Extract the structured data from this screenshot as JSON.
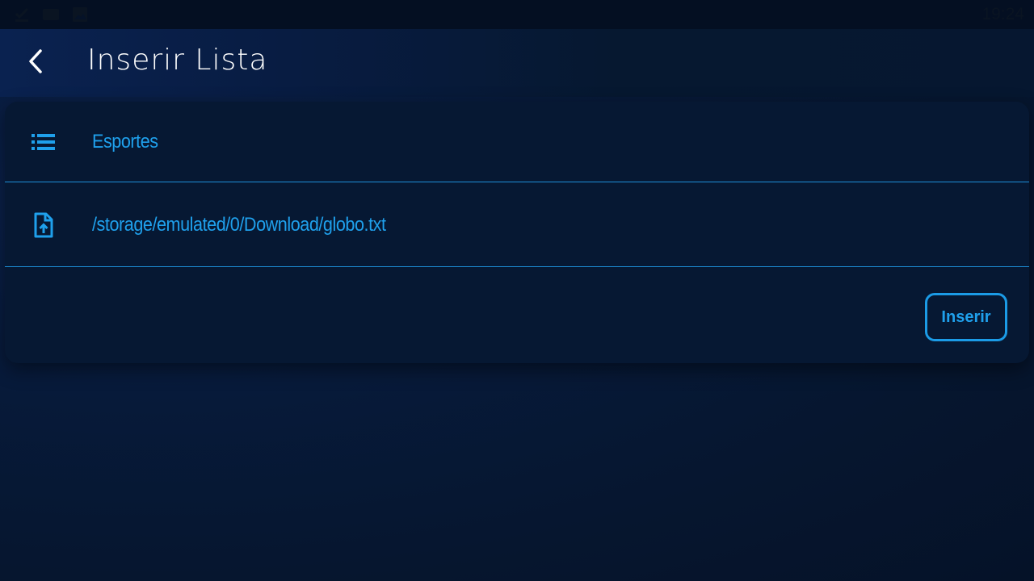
{
  "status_bar": {
    "time": "19:24",
    "icons": [
      "download-done-icon",
      "message-icon",
      "image-icon"
    ]
  },
  "app_bar": {
    "title": "Inserir Lista",
    "back_icon": "back-arrow-icon"
  },
  "form": {
    "fields": [
      {
        "icon": "list-icon",
        "value": "Esportes"
      },
      {
        "icon": "file-upload-icon",
        "value": "/storage/emulated/0/Download/globo.txt"
      }
    ],
    "submit_label": "Inserir"
  },
  "colors": {
    "accent": "#1fa0ec",
    "background": "#06162f",
    "card": "#061833",
    "status_bar": "#040f22"
  }
}
